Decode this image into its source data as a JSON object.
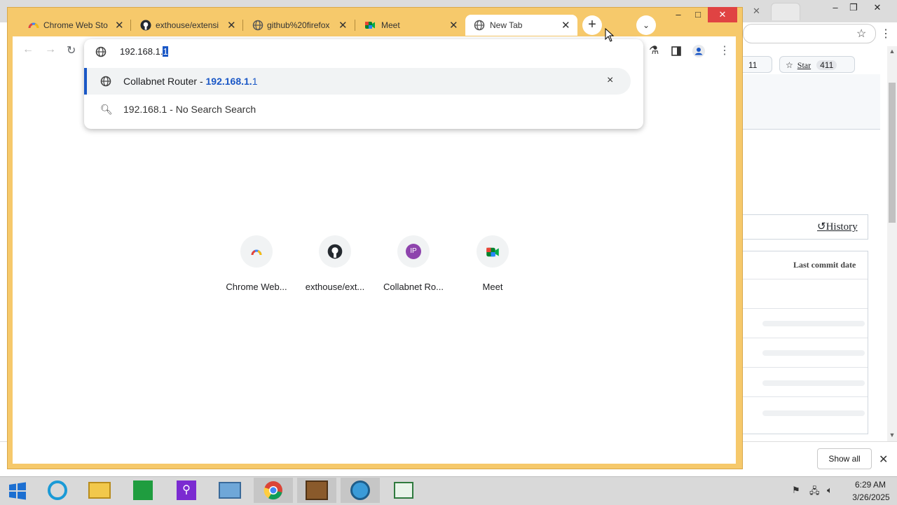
{
  "front_browser": {
    "tabs": [
      {
        "title": "Chrome Web Store",
        "icon": "chrome-web-store-icon"
      },
      {
        "title": "exthouse/extensions",
        "icon": "github-icon"
      },
      {
        "title": "github%20firefox",
        "icon": "globe-icon"
      },
      {
        "title": "Meet",
        "icon": "google-meet-icon"
      },
      {
        "title": "New Tab",
        "icon": "globe-icon",
        "active": true
      }
    ],
    "new_tab_label": "+",
    "tab_search_label": "⌄",
    "omnibox": {
      "text_plain": "192.168.1.",
      "text_selected": "1",
      "suggestions": [
        {
          "title": "Collabnet Router",
          "separator": " - ",
          "url_bold": "192.168.1.",
          "url_rest": "1",
          "remove_label": "×"
        },
        {
          "text": "192.168.1 - No Search Search"
        }
      ]
    },
    "shortcuts": [
      {
        "label": "Chrome Web...",
        "icon": "chrome-web-store-icon"
      },
      {
        "label": "exthouse/ext...",
        "icon": "github-icon"
      },
      {
        "label": "Collabnet Ro...",
        "icon": "ip-badge",
        "badge_text": "IP"
      },
      {
        "label": "Meet",
        "icon": "google-meet-icon"
      }
    ],
    "window_controls": {
      "minimize": "–",
      "maximize": "□",
      "close": "✕"
    }
  },
  "background_browser": {
    "github": {
      "fork_count": "11",
      "star_label": "Star",
      "star_count": "411",
      "history_label": "History",
      "last_commit_header": "Last commit date"
    },
    "download_bar": {
      "show_all_label": "Show all",
      "close_label": "✕"
    },
    "window_controls": {
      "minimize": "–",
      "restore": "❐",
      "close": "✕"
    }
  },
  "taskbar": {
    "apps": [
      "start-button",
      "internet-explorer",
      "file-explorer",
      "store",
      "search-app",
      "control-panel",
      "chrome",
      "archive-app",
      "network-app",
      "notepad-app"
    ],
    "clock": {
      "time": "6:29 AM",
      "date": "3/26/2025"
    }
  },
  "colors": {
    "accent": "#1a57c6",
    "frame": "#f6c96b"
  }
}
